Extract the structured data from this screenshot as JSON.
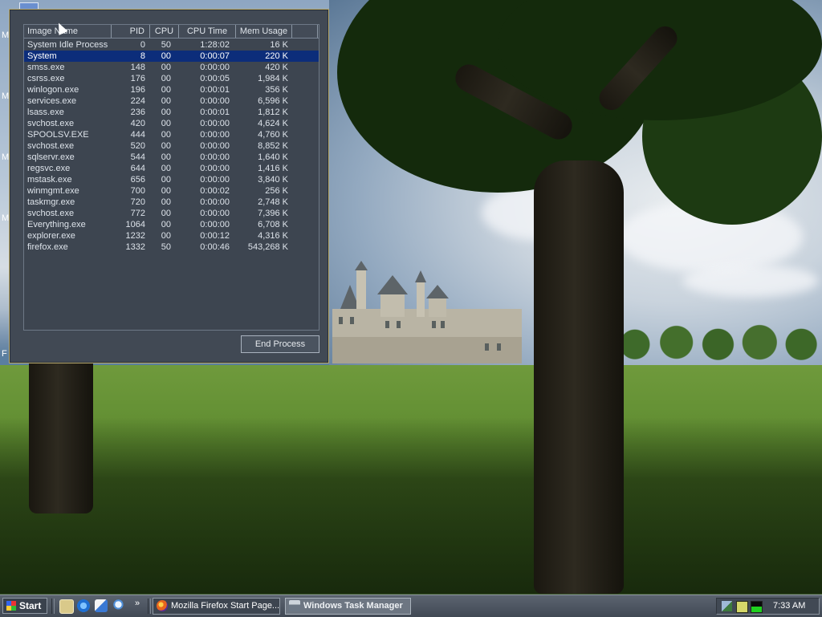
{
  "desktop": {
    "edge_letters": [
      "M",
      "M",
      "M",
      "M",
      "F"
    ]
  },
  "task_manager": {
    "columns": [
      "Image Name",
      "PID",
      "CPU",
      "CPU Time",
      "Mem Usage"
    ],
    "selected_index": 1,
    "processes": [
      {
        "name": "System Idle Process",
        "pid": "0",
        "cpu": "50",
        "time": "1:28:02",
        "mem": "16 K"
      },
      {
        "name": "System",
        "pid": "8",
        "cpu": "00",
        "time": "0:00:07",
        "mem": "220 K"
      },
      {
        "name": "smss.exe",
        "pid": "148",
        "cpu": "00",
        "time": "0:00:00",
        "mem": "420 K"
      },
      {
        "name": "csrss.exe",
        "pid": "176",
        "cpu": "00",
        "time": "0:00:05",
        "mem": "1,984 K"
      },
      {
        "name": "winlogon.exe",
        "pid": "196",
        "cpu": "00",
        "time": "0:00:01",
        "mem": "356 K"
      },
      {
        "name": "services.exe",
        "pid": "224",
        "cpu": "00",
        "time": "0:00:00",
        "mem": "6,596 K"
      },
      {
        "name": "lsass.exe",
        "pid": "236",
        "cpu": "00",
        "time": "0:00:01",
        "mem": "1,812 K"
      },
      {
        "name": "svchost.exe",
        "pid": "420",
        "cpu": "00",
        "time": "0:00:00",
        "mem": "4,624 K"
      },
      {
        "name": "SPOOLSV.EXE",
        "pid": "444",
        "cpu": "00",
        "time": "0:00:00",
        "mem": "4,760 K"
      },
      {
        "name": "svchost.exe",
        "pid": "520",
        "cpu": "00",
        "time": "0:00:00",
        "mem": "8,852 K"
      },
      {
        "name": "sqlservr.exe",
        "pid": "544",
        "cpu": "00",
        "time": "0:00:00",
        "mem": "1,640 K"
      },
      {
        "name": "regsvc.exe",
        "pid": "644",
        "cpu": "00",
        "time": "0:00:00",
        "mem": "1,416 K"
      },
      {
        "name": "mstask.exe",
        "pid": "656",
        "cpu": "00",
        "time": "0:00:00",
        "mem": "3,840 K"
      },
      {
        "name": "winmgmt.exe",
        "pid": "700",
        "cpu": "00",
        "time": "0:00:02",
        "mem": "256 K"
      },
      {
        "name": "taskmgr.exe",
        "pid": "720",
        "cpu": "00",
        "time": "0:00:00",
        "mem": "2,748 K"
      },
      {
        "name": "svchost.exe",
        "pid": "772",
        "cpu": "00",
        "time": "0:00:00",
        "mem": "7,396 K"
      },
      {
        "name": "Everything.exe",
        "pid": "1064",
        "cpu": "00",
        "time": "0:00:00",
        "mem": "6,708 K"
      },
      {
        "name": "explorer.exe",
        "pid": "1232",
        "cpu": "00",
        "time": "0:00:12",
        "mem": "4,316 K"
      },
      {
        "name": "firefox.exe",
        "pid": "1332",
        "cpu": "50",
        "time": "0:00:46",
        "mem": "543,268 K"
      }
    ],
    "end_process_label": "End Process"
  },
  "taskbar": {
    "start_label": "Start",
    "chevron": "»",
    "quick_launch": [
      "show-desktop-icon",
      "internet-explorer-icon",
      "outlook-express-icon",
      "search-icon"
    ],
    "tasks": [
      {
        "label": "Mozilla Firefox Start Page...",
        "active": false,
        "icon": "firefox-icon"
      },
      {
        "label": "Windows Task Manager",
        "active": true,
        "icon": "task-manager-icon"
      }
    ],
    "tray_icons": [
      "network-icon",
      "task-manager-tray-icon",
      "cpu-meter-icon"
    ],
    "clock": "7:33 AM"
  },
  "colors": {
    "selection": "#0c2d7a",
    "window_bg": "#414954",
    "window_border": "#b7a86c"
  }
}
